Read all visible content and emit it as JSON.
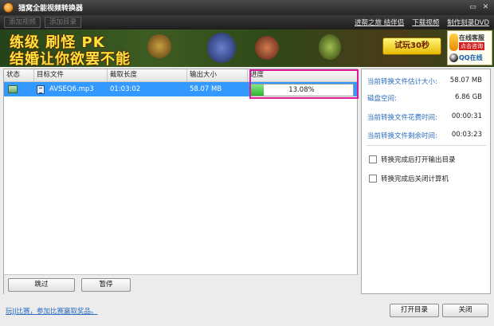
{
  "window": {
    "title": "猎窝全能视频转换器",
    "minimize_glyph": "▭",
    "close_glyph": "✕"
  },
  "toolbar": {
    "add_video_label": "添加视频",
    "add_folder_label": "添加目录"
  },
  "top_links": [
    {
      "label": "进帮之旅 结伴侣"
    },
    {
      "label": "下载视频"
    },
    {
      "label": "制作刻录DVD"
    }
  ],
  "banner": {
    "line1": "练级 刷怪 PK",
    "line2": "结婚让你欲罢不能",
    "trial_button": "试玩30秒",
    "service_line1": "在线客服",
    "service_line2": "点击咨询",
    "qq_label": "QQ在线"
  },
  "table": {
    "columns": [
      "状态",
      "目标文件",
      "截取长度",
      "输出大小",
      "进度"
    ],
    "rows": [
      {
        "file": "AVSEQ6.mp3",
        "length": "01:03:02",
        "size": "58.07 MB",
        "progress_text": "13.08%",
        "progress_fraction": 0.1308
      }
    ]
  },
  "buttons": {
    "skip": "跳过",
    "pause": "暂停",
    "open_dir": "打开目录",
    "close": "关闭"
  },
  "info": {
    "estimated_size_label": "当前转换文件估计大小:",
    "estimated_size_value": "58.07 MB",
    "disk_space_label": "磁盘空间:",
    "disk_space_value": "6.86 GB",
    "time_spent_label": "当前转换文件花费时间:",
    "time_spent_value": "00:00:31",
    "time_left_label": "当前转换文件剩余时间:",
    "time_left_value": "00:03:23",
    "open_output_label": "转换完成后打开输出目录",
    "shutdown_label": "转换完成后关闭计算机"
  },
  "footer": {
    "link": "玩JJ比赛，参加比赛赢取奖品。"
  },
  "colors": {
    "selected_row": "#3399ff",
    "progress": "#2fb52f",
    "highlight_border": "#e0189a",
    "link": "#2a6dbf"
  }
}
